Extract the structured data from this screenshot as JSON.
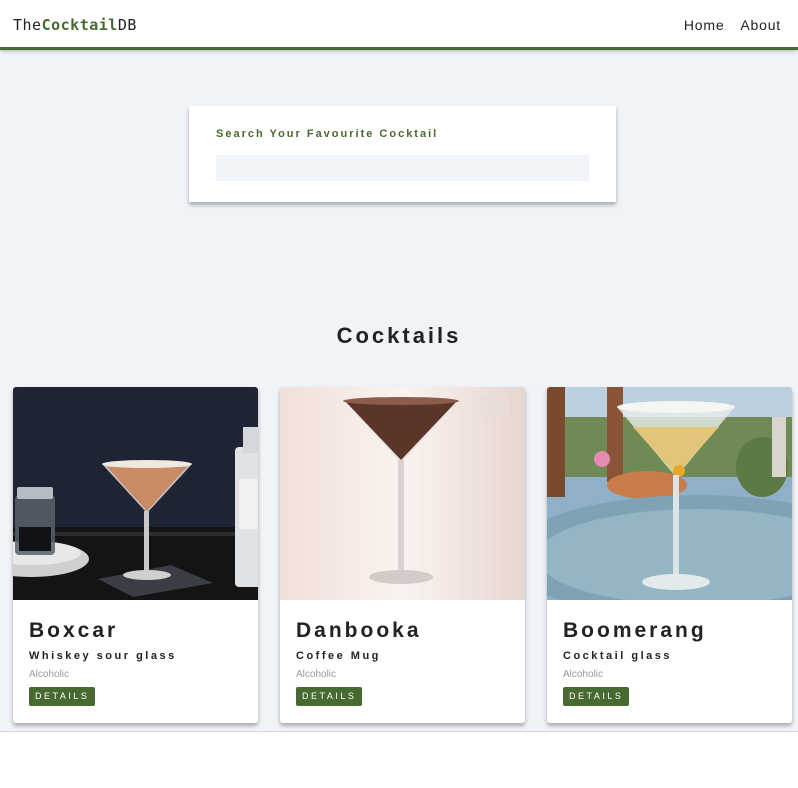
{
  "navbar": {
    "logo_prefix": "The",
    "logo_brand": "Cocktail",
    "logo_suffix": "DB",
    "links": [
      {
        "label": "Home"
      },
      {
        "label": "About"
      }
    ]
  },
  "search": {
    "label": "Search Your Favourite Cocktail",
    "value": "",
    "placeholder": ""
  },
  "section_title": "Cocktails",
  "cocktails": [
    {
      "name": "Boxcar",
      "glass": "Whiskey sour glass",
      "type": "Alcoholic",
      "button": "DETAILS",
      "image": "martini-glass-dark-background"
    },
    {
      "name": "Danbooka",
      "glass": "Coffee Mug",
      "type": "Alcoholic",
      "button": "DETAILS",
      "image": "martini-glass-light-background"
    },
    {
      "name": "Boomerang",
      "glass": "Cocktail glass",
      "type": "Alcoholic",
      "button": "DETAILS",
      "image": "martini-glass-outdoor-background"
    }
  ],
  "colors": {
    "accent": "#476a30",
    "page_bg": "#f0f3f8",
    "text": "#222222"
  }
}
